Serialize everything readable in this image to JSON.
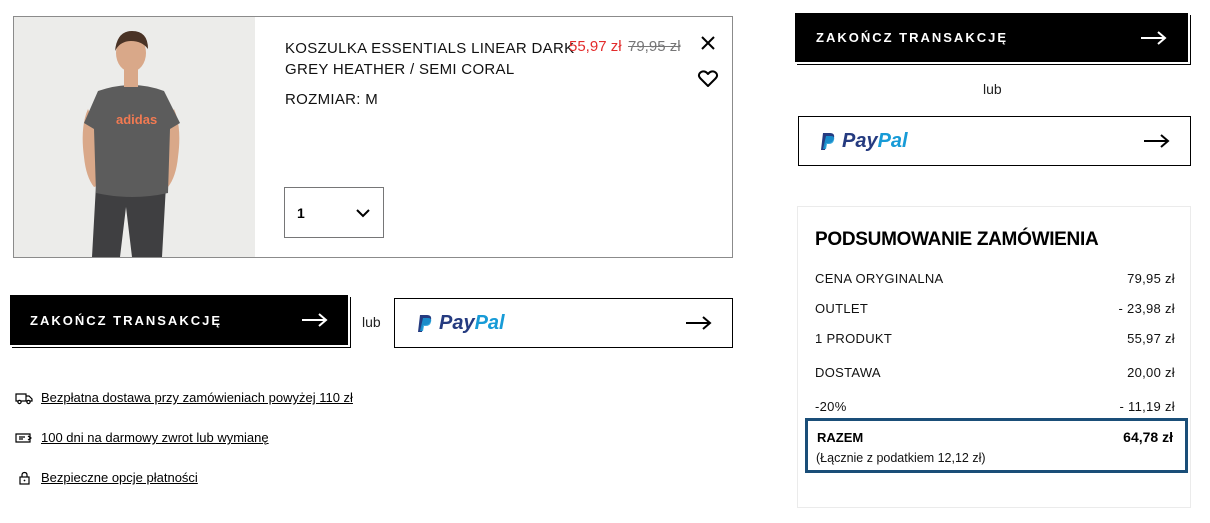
{
  "product": {
    "name": "KOSZULKA ESSENTIALS LINEAR DARK GREY HEATHER / SEMI CORAL",
    "size": "ROZMIAR: M",
    "price_sale": "55,97 zł",
    "price_original": "79,95 zł",
    "quantity": "1",
    "image_icon": "product-photo-tshirt",
    "shirt_print": "adidas",
    "colors": {
      "sale_price": "#e32b2b",
      "shirt": "#5c5c5c",
      "print": "#f27a52"
    }
  },
  "actions": {
    "checkout_label": "ZAKOŃCZ TRANSAKCJĘ",
    "or_label": "lub",
    "paypal_pay": "Pay",
    "paypal_pal": "Pal"
  },
  "info": {
    "delivery": "Bezpłatna dostawa przy zamówieniach powyżej 110 zł",
    "returns": "100 dni na darmowy zwrot lub wymianę",
    "secure": "Bezpieczne opcje płatności"
  },
  "summary": {
    "title": "PODSUMOWANIE ZAMÓWIENIA",
    "rows": [
      {
        "label": "CENA ORYGINALNA",
        "value": "79,95 zł"
      },
      {
        "label": "OUTLET",
        "value": "- 23,98 zł"
      },
      {
        "label": "1 PRODUKT",
        "value": "55,97 zł"
      },
      {
        "label": "DOSTAWA",
        "value": "20,00 zł"
      },
      {
        "label": "-20%",
        "value": "- 11,19 zł"
      }
    ],
    "total_label": "RAZEM",
    "total_value": "64,78 zł",
    "tax_note": "(Łącznie z podatkiem  12,12 zł)",
    "highlight_color": "#1a4e78"
  }
}
